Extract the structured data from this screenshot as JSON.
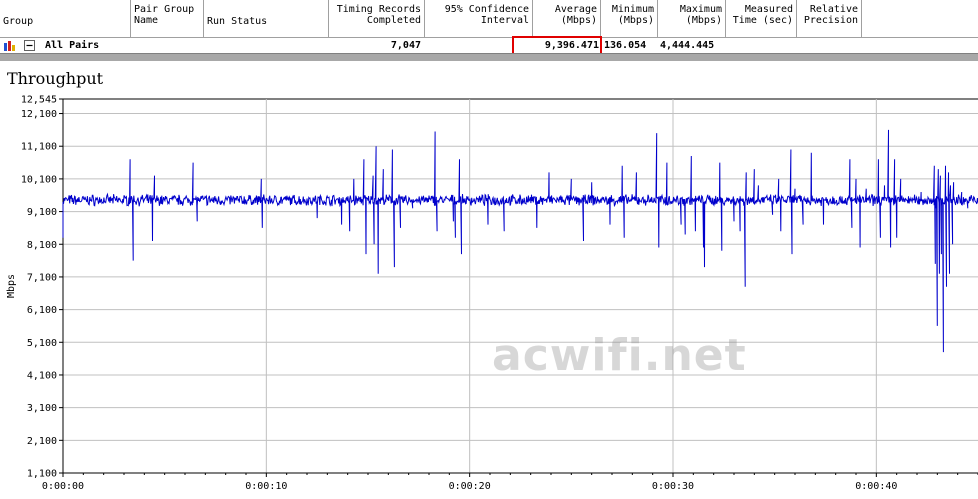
{
  "table": {
    "headers": [
      {
        "label": "Group"
      },
      {
        "label": "Pair Group\nName"
      },
      {
        "label": "Run Status"
      },
      {
        "label": "Timing Records\nCompleted"
      },
      {
        "label": "95% Confidence\nInterval"
      },
      {
        "label": "Average\n(Mbps)"
      },
      {
        "label": "Minimum\n(Mbps)"
      },
      {
        "label": "Maximum\n(Mbps)"
      },
      {
        "label": "Measured\nTime (sec)"
      },
      {
        "label": "Relative\nPrecision"
      }
    ],
    "row": {
      "name": "All Pairs",
      "timing_records": "7,047",
      "average": "9,396.471",
      "minimum": "136.054",
      "maximum": "4,444.445"
    }
  },
  "chart_title": "Throughput",
  "watermark": "acwifi.net",
  "colors": {
    "series": "#0000cc",
    "grid": "#c0c0c0",
    "highlight": "#e00000"
  },
  "chart_data": {
    "type": "line",
    "title": "Throughput",
    "xlabel": "",
    "ylabel": "Mbps",
    "x_range_seconds": [
      0,
      45
    ],
    "y_range": [
      1100,
      12545
    ],
    "y_ticks": [
      "12,545",
      "12,100",
      "11,100",
      "10,100",
      "9,100",
      "8,100",
      "7,100",
      "6,100",
      "5,100",
      "4,100",
      "3,100",
      "2,100",
      "1,100"
    ],
    "y_tick_values": [
      12545,
      12100,
      11100,
      10100,
      9100,
      8100,
      7100,
      6100,
      5100,
      4100,
      3100,
      2100,
      1100
    ],
    "x_ticks": [
      "0:00:00",
      "0:00:10",
      "0:00:20",
      "0:00:30",
      "0:00:40"
    ],
    "x_tick_values": [
      0,
      10,
      20,
      30,
      40
    ],
    "grid": true,
    "series": [
      {
        "baseline": 9450,
        "spikes": [
          [
            0.0,
            8300
          ],
          [
            3.3,
            10700
          ],
          [
            3.45,
            7600
          ],
          [
            4.4,
            8200
          ],
          [
            4.5,
            10200
          ],
          [
            6.4,
            10600
          ],
          [
            6.6,
            8800
          ],
          [
            9.75,
            10100
          ],
          [
            9.8,
            8600
          ],
          [
            12.5,
            8900
          ],
          [
            13.7,
            8700
          ],
          [
            14.1,
            8500
          ],
          [
            14.3,
            10100
          ],
          [
            14.8,
            10700
          ],
          [
            14.9,
            7800
          ],
          [
            15.25,
            10200
          ],
          [
            15.3,
            8100
          ],
          [
            15.4,
            11100
          ],
          [
            15.5,
            7200
          ],
          [
            15.75,
            10400
          ],
          [
            16.2,
            11000
          ],
          [
            16.3,
            7400
          ],
          [
            16.6,
            8600
          ],
          [
            17.2,
            9200
          ],
          [
            18.3,
            11550
          ],
          [
            18.4,
            8500
          ],
          [
            19.2,
            8800
          ],
          [
            19.3,
            8300
          ],
          [
            19.5,
            10700
          ],
          [
            19.6,
            7800
          ],
          [
            20.9,
            8700
          ],
          [
            21.7,
            8500
          ],
          [
            23.3,
            8600
          ],
          [
            23.9,
            10300
          ],
          [
            25.0,
            10100
          ],
          [
            25.6,
            8200
          ],
          [
            26.0,
            10000
          ],
          [
            26.9,
            8700
          ],
          [
            27.5,
            10500
          ],
          [
            27.6,
            8300
          ],
          [
            28.2,
            10300
          ],
          [
            29.2,
            11500
          ],
          [
            29.3,
            8000
          ],
          [
            29.7,
            10600
          ],
          [
            30.4,
            8700
          ],
          [
            30.6,
            8400
          ],
          [
            30.9,
            10800
          ],
          [
            31.1,
            8500
          ],
          [
            31.5,
            8000
          ],
          [
            31.55,
            7400
          ],
          [
            32.3,
            10600
          ],
          [
            32.4,
            7900
          ],
          [
            33.0,
            8800
          ],
          [
            33.3,
            8500
          ],
          [
            33.55,
            6800
          ],
          [
            33.6,
            10300
          ],
          [
            34.0,
            10400
          ],
          [
            34.2,
            9900
          ],
          [
            34.9,
            9000
          ],
          [
            35.2,
            10100
          ],
          [
            35.3,
            8500
          ],
          [
            35.8,
            11000
          ],
          [
            35.85,
            7800
          ],
          [
            36.0,
            9800
          ],
          [
            36.4,
            8700
          ],
          [
            36.8,
            10900
          ],
          [
            37.4,
            8700
          ],
          [
            38.7,
            10700
          ],
          [
            38.8,
            8600
          ],
          [
            39.0,
            10100
          ],
          [
            39.2,
            8000
          ],
          [
            39.5,
            9800
          ],
          [
            40.1,
            10700
          ],
          [
            40.2,
            8300
          ],
          [
            40.4,
            9900
          ],
          [
            40.6,
            11600
          ],
          [
            40.7,
            8000
          ],
          [
            40.9,
            10700
          ],
          [
            41.0,
            8300
          ],
          [
            41.2,
            10100
          ],
          [
            42.2,
            9700
          ],
          [
            42.3,
            9300
          ],
          [
            42.85,
            10500
          ],
          [
            42.9,
            7500
          ],
          [
            42.95,
            9200
          ],
          [
            43.0,
            5600
          ],
          [
            43.05,
            10400
          ],
          [
            43.1,
            7200
          ],
          [
            43.15,
            10200
          ],
          [
            43.2,
            7800
          ],
          [
            43.3,
            4800
          ],
          [
            43.4,
            10500
          ],
          [
            43.45,
            6800
          ],
          [
            43.55,
            10300
          ],
          [
            43.6,
            7200
          ],
          [
            43.65,
            9900
          ],
          [
            43.75,
            8100
          ],
          [
            43.8,
            10000
          ],
          [
            43.9,
            9300
          ],
          [
            44.2,
            9700
          ],
          [
            44.5,
            9200
          ]
        ]
      }
    ]
  }
}
